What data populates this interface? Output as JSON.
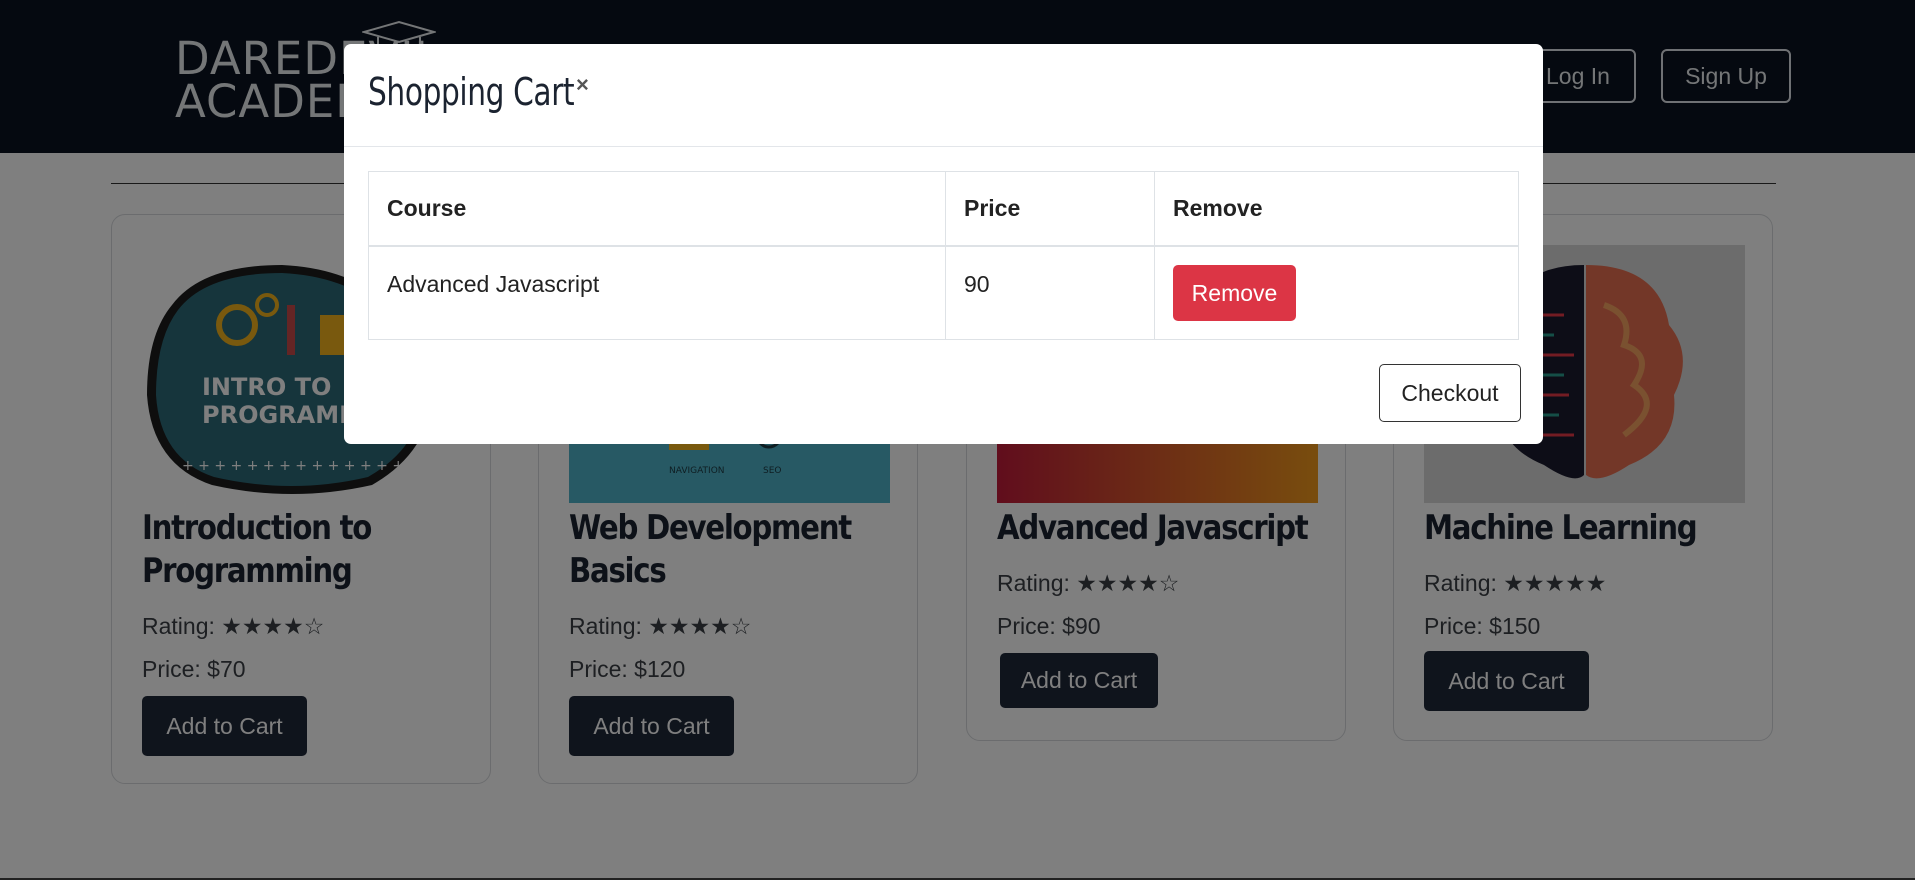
{
  "header": {
    "brand_line1": "DAREDEVIL",
    "brand_line2": "ACADEMY",
    "login_label": "Log In",
    "signup_label": "Sign Up"
  },
  "courses": [
    {
      "title_line1": "Introduction to",
      "title_line2": "Programming",
      "rating": "Rating: ★★★★☆",
      "price": "Price: $70",
      "button": "Add to Cart",
      "image_text": "INTRO TO PROGRAMMING"
    },
    {
      "title_line1": "Web Development",
      "title_line2": "Basics",
      "rating": "Rating: ★★★★☆",
      "price": "Price: $120",
      "button": "Add to Cart",
      "image_text": "NAVIGATION"
    },
    {
      "title_line1": "Advanced Javascript",
      "title_line2": "",
      "rating": "Rating: ★★★★☆",
      "price": "Price: $90",
      "button": "Add to Cart"
    },
    {
      "title_line1": "Machine Learning",
      "title_line2": "",
      "rating": "Rating: ★★★★★",
      "price": "Price: $150",
      "button": "Add to Cart"
    }
  ],
  "modal": {
    "title": "Shopping Cart",
    "close_symbol": "×",
    "columns": [
      "Course",
      "Price",
      "Remove"
    ],
    "rows": [
      {
        "course": "Advanced Javascript",
        "price": "90",
        "action": "Remove"
      }
    ],
    "checkout_label": "Checkout"
  },
  "colors": {
    "navbar": "#0b1220",
    "button_dark": "#1e2839",
    "danger": "#dc3545"
  }
}
